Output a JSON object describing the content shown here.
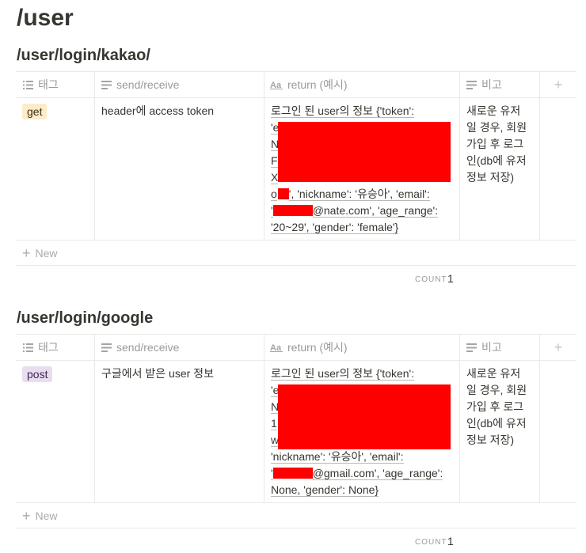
{
  "page_title": "/user",
  "new_label": "New",
  "count_label": "COUNT",
  "columns": {
    "tag": "태그",
    "send": "send/receive",
    "ret": "return (예시)",
    "note": "비고"
  },
  "sections": [
    {
      "title": "/user/login/kakao/",
      "row": {
        "tag": "get",
        "tag_bg": "#fdecc8",
        "tag_color": "#402c1b",
        "send": "header에 access token",
        "ret_lines": [
          "로그인 된 user의 정보 {'token':",
          "'e",
          "N",
          "F",
          "X",
          "o",
          "', 'nickname': '유승아', 'email':",
          "@nate.com', 'age_range':",
          "'20~29', 'gender': 'female'}"
        ],
        "note_lines": [
          "새로운 유저",
          "일 경우, 회원",
          "가입 후 로그",
          "인(db에 유저",
          "정보 저장)"
        ]
      },
      "count": "1"
    },
    {
      "title": "/user/login/google",
      "row": {
        "tag": "post",
        "tag_bg": "#e8deee",
        "tag_color": "#412454",
        "send": "구글에서 받은 user 정보",
        "ret_lines": [
          "로그인 된 user의 정보 {'token':",
          "'e",
          "N",
          "1",
          "w",
          "'nickname': '유승아', 'email':",
          "@gmail.com', 'age_range':",
          "None, 'gender': None}"
        ],
        "note_lines": [
          "새로운 유저",
          "일 경우, 회원",
          "가입 후 로그",
          "인(db에 유저",
          "정보 저장)"
        ]
      },
      "count": "1"
    }
  ]
}
